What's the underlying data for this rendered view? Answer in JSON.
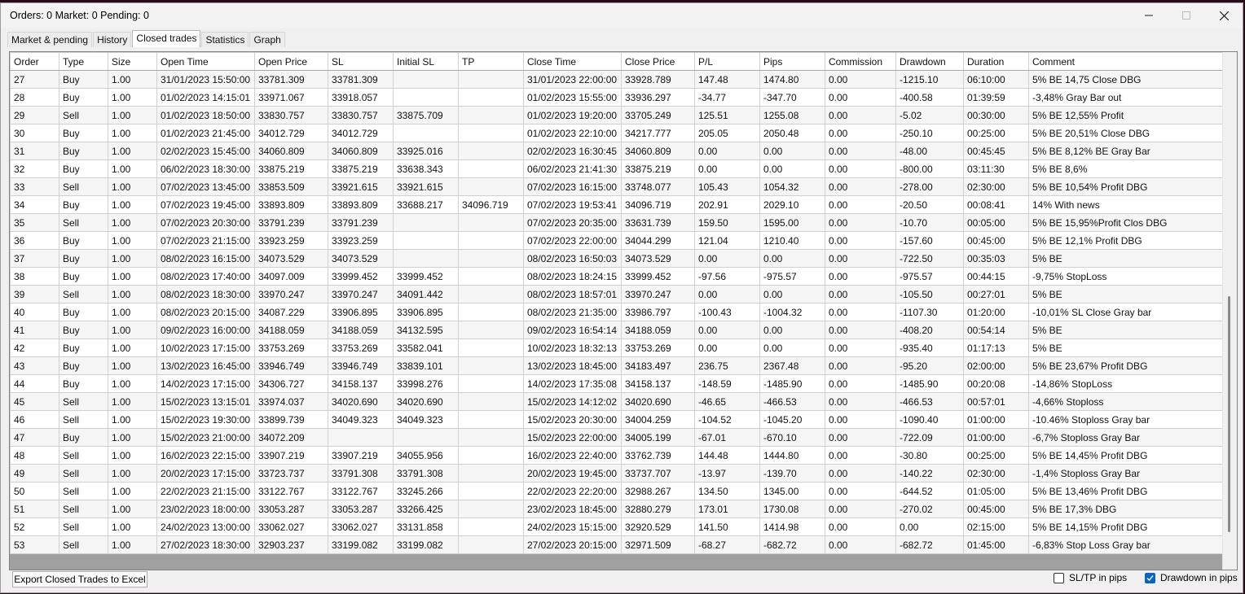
{
  "window": {
    "title": "Orders: 0   Market: 0   Pending: 0"
  },
  "tabs": [
    "Market & pending",
    "History",
    "Closed trades",
    "Statistics",
    "Graph"
  ],
  "active_tab": 2,
  "table": {
    "columns": [
      "Order",
      "Type",
      "Size",
      "Open Time",
      "Open Price",
      "SL",
      "Initial SL",
      "TP",
      "Close Time",
      "Close Price",
      "P/L",
      "Pips",
      "Commission",
      "Drawdown",
      "Duration",
      "Comment"
    ],
    "rows": [
      [
        "27",
        "Buy",
        "1.00",
        "31/01/2023 15:50:00",
        "33781.309",
        "33781.309",
        "",
        "",
        "31/01/2023 22:00:00",
        "33928.789",
        "147.48",
        "1474.80",
        "0.00",
        "-1215.10",
        "06:10:00",
        "5% BE 14,75 Close DBG"
      ],
      [
        "28",
        "Buy",
        "1.00",
        "01/02/2023 14:15:01",
        "33971.067",
        "33918.057",
        "",
        "",
        "01/02/2023 15:55:00",
        "33936.297",
        "-34.77",
        "-347.70",
        "0.00",
        "-400.58",
        "01:39:59",
        "-3,48%  Gray Bar out"
      ],
      [
        "29",
        "Sell",
        "1.00",
        "01/02/2023 18:50:00",
        "33830.757",
        "33830.757",
        "33875.709",
        "",
        "01/02/2023 19:20:00",
        "33705.249",
        "125.51",
        "1255.08",
        "0.00",
        "-5.02",
        "00:30:00",
        "5% BE 12,55% Profit"
      ],
      [
        "30",
        "Buy",
        "1.00",
        "01/02/2023 21:45:00",
        "34012.729",
        "34012.729",
        "",
        "",
        "01/02/2023 22:10:00",
        "34217.777",
        "205.05",
        "2050.48",
        "0.00",
        "-250.10",
        "00:25:00",
        "5% BE 20,51% Close DBG"
      ],
      [
        "31",
        "Buy",
        "1.00",
        "02/02/2023 15:45:00",
        "34060.809",
        "34060.809",
        "33925.016",
        "",
        "02/02/2023 16:30:45",
        "34060.809",
        "0.00",
        "0.00",
        "0.00",
        "-48.00",
        "00:45:45",
        "5% BE 8,12% BE Gray Bar"
      ],
      [
        "32",
        "Buy",
        "1.00",
        "06/02/2023 18:30:00",
        "33875.219",
        "33875.219",
        "33638.343",
        "",
        "06/02/2023 21:41:30",
        "33875.219",
        "0.00",
        "0.00",
        "0.00",
        "-800.00",
        "03:11:30",
        "5% BE 8,6%"
      ],
      [
        "33",
        "Sell",
        "1.00",
        "07/02/2023 13:45:00",
        "33853.509",
        "33921.615",
        "33921.615",
        "",
        "07/02/2023 16:15:00",
        "33748.077",
        "105.43",
        "1054.32",
        "0.00",
        "-278.00",
        "02:30:00",
        "5% BE 10,54% Profit DBG"
      ],
      [
        "34",
        "Buy",
        "1.00",
        "07/02/2023 19:45:00",
        "33893.809",
        "33893.809",
        "33688.217",
        "34096.719",
        "07/02/2023 19:53:41",
        "34096.719",
        "202.91",
        "2029.10",
        "0.00",
        "-20.50",
        "00:08:41",
        "14% With news"
      ],
      [
        "35",
        "Sell",
        "1.00",
        "07/02/2023 20:30:00",
        "33791.239",
        "33791.239",
        "",
        "",
        "07/02/2023 20:35:00",
        "33631.739",
        "159.50",
        "1595.00",
        "0.00",
        "-10.70",
        "00:05:00",
        "5% BE 15,95%Profit Clos DBG"
      ],
      [
        "36",
        "Buy",
        "1.00",
        "07/02/2023 21:15:00",
        "33923.259",
        "33923.259",
        "",
        "",
        "07/02/2023 22:00:00",
        "34044.299",
        "121.04",
        "1210.40",
        "0.00",
        "-157.60",
        "00:45:00",
        "5% BE 12,1% Profit DBG"
      ],
      [
        "37",
        "Buy",
        "1.00",
        "08/02/2023 16:15:00",
        "34073.529",
        "34073.529",
        "",
        "",
        "08/02/2023 16:50:03",
        "34073.529",
        "0.00",
        "0.00",
        "0.00",
        "-722.50",
        "00:35:03",
        "5% BE"
      ],
      [
        "38",
        "Buy",
        "1.00",
        "08/02/2023 17:40:00",
        "34097.009",
        "33999.452",
        "33999.452",
        "",
        "08/02/2023 18:24:15",
        "33999.452",
        "-97.56",
        "-975.57",
        "0.00",
        "-975.57",
        "00:44:15",
        "-9,75% StopLoss"
      ],
      [
        "39",
        "Sell",
        "1.00",
        "08/02/2023 18:30:00",
        "33970.247",
        "33970.247",
        "34091.442",
        "",
        "08/02/2023 18:57:01",
        "33970.247",
        "0.00",
        "0.00",
        "0.00",
        "-105.50",
        "00:27:01",
        "5% BE"
      ],
      [
        "40",
        "Buy",
        "1.00",
        "08/02/2023 20:15:00",
        "34087.229",
        "33906.895",
        "33906.895",
        "",
        "08/02/2023 21:35:00",
        "33986.797",
        "-100.43",
        "-1004.32",
        "0.00",
        "-1107.30",
        "01:20:00",
        "-10,01% SL Close Gray bar"
      ],
      [
        "41",
        "Buy",
        "1.00",
        "09/02/2023 16:00:00",
        "34188.059",
        "34188.059",
        "34132.595",
        "",
        "09/02/2023 16:54:14",
        "34188.059",
        "0.00",
        "0.00",
        "0.00",
        "-408.20",
        "00:54:14",
        "5% BE"
      ],
      [
        "42",
        "Buy",
        "1.00",
        "10/02/2023 17:15:00",
        "33753.269",
        "33753.269",
        "33582.041",
        "",
        "10/02/2023 18:32:13",
        "33753.269",
        "0.00",
        "0.00",
        "0.00",
        "-935.40",
        "01:17:13",
        "5% BE"
      ],
      [
        "43",
        "Buy",
        "1.00",
        "13/02/2023 16:45:00",
        "33946.749",
        "33946.749",
        "33839.101",
        "",
        "13/02/2023 18:45:00",
        "34183.497",
        "236.75",
        "2367.48",
        "0.00",
        "-95.20",
        "02:00:00",
        "5% BE 23,67% Profit DBG"
      ],
      [
        "44",
        "Buy",
        "1.00",
        "14/02/2023 17:15:00",
        "34306.727",
        "34158.137",
        "33998.276",
        "",
        "14/02/2023 17:35:08",
        "34158.137",
        "-148.59",
        "-1485.90",
        "0.00",
        "-1485.90",
        "00:20:08",
        "-14,86% StopLoss"
      ],
      [
        "45",
        "Sell",
        "1.00",
        "15/02/2023 13:15:01",
        "33974.037",
        "34020.690",
        "34020.690",
        "",
        "15/02/2023 14:12:02",
        "34020.690",
        "-46.65",
        "-466.53",
        "0.00",
        "-466.53",
        "00:57:01",
        "-4,66% Stoploss"
      ],
      [
        "46",
        "Sell",
        "1.00",
        "15/02/2023 19:30:00",
        "33899.739",
        "34049.323",
        "34049.323",
        "",
        "15/02/2023 20:30:00",
        "34004.259",
        "-104.52",
        "-1045.20",
        "0.00",
        "-1090.40",
        "01:00:00",
        "-10.46% Stoploss Gray bar"
      ],
      [
        "47",
        "Buy",
        "1.00",
        "15/02/2023 21:00:00",
        "34072.209",
        "",
        "",
        "",
        "15/02/2023 22:00:00",
        "34005.199",
        "-67.01",
        "-670.10",
        "0.00",
        "-722.09",
        "01:00:00",
        "-6,7% Stoploss Gray Bar"
      ],
      [
        "48",
        "Sell",
        "1.00",
        "16/02/2023 22:15:00",
        "33907.219",
        "33907.219",
        "34055.956",
        "",
        "16/02/2023 22:40:00",
        "33762.739",
        "144.48",
        "1444.80",
        "0.00",
        "-30.80",
        "00:25:00",
        "5% BE 14,45% Profit DBG"
      ],
      [
        "49",
        "Sell",
        "1.00",
        "20/02/2023 17:15:00",
        "33723.737",
        "33791.308",
        "33791.308",
        "",
        "20/02/2023 19:45:00",
        "33737.707",
        "-13.97",
        "-139.70",
        "0.00",
        "-140.22",
        "02:30:00",
        "-1,4% Stoploss Gray Bar"
      ],
      [
        "50",
        "Sell",
        "1.00",
        "22/02/2023 21:15:00",
        "33122.767",
        "33122.767",
        "33245.266",
        "",
        "22/02/2023 22:20:00",
        "32988.267",
        "134.50",
        "1345.00",
        "0.00",
        "-644.52",
        "01:05:00",
        "5% BE 13,46% Profit DBG"
      ],
      [
        "51",
        "Sell",
        "1.00",
        "23/02/2023 18:00:00",
        "33053.287",
        "33053.287",
        "33266.425",
        "",
        "23/02/2023 18:45:00",
        "32880.279",
        "173.01",
        "1730.08",
        "0.00",
        "-270.02",
        "00:45:00",
        "5% BE 17,3% DBG"
      ],
      [
        "52",
        "Sell",
        "1.00",
        "24/02/2023 13:00:00",
        "33062.027",
        "33062.027",
        "33131.858",
        "",
        "24/02/2023 15:15:00",
        "32920.529",
        "141.50",
        "1414.98",
        "0.00",
        "0.00",
        "02:15:00",
        "5% BE 14,15% Profit DBG"
      ],
      [
        "53",
        "Sell",
        "1.00",
        "27/02/2023 18:30:00",
        "32903.237",
        "33199.082",
        "33199.082",
        "",
        "27/02/2023 20:15:00",
        "32971.509",
        "-68.27",
        "-682.72",
        "0.00",
        "-682.72",
        "01:45:00",
        "-6,83% Stop Loss Gray bar"
      ]
    ]
  },
  "footer": {
    "export_label": "Export Closed Trades to Excel",
    "sltp_label": "SL/TP in pips",
    "sltp_checked": false,
    "drawdown_label": "Drawdown in pips",
    "drawdown_checked": true
  },
  "colors": {
    "accent": "#0a64c8",
    "grid_empty": "#a0a0a0",
    "alt_row": "#f5f5f5"
  },
  "icons": [
    "minimize-icon",
    "maximize-icon",
    "close-icon",
    "checkmark-icon"
  ]
}
